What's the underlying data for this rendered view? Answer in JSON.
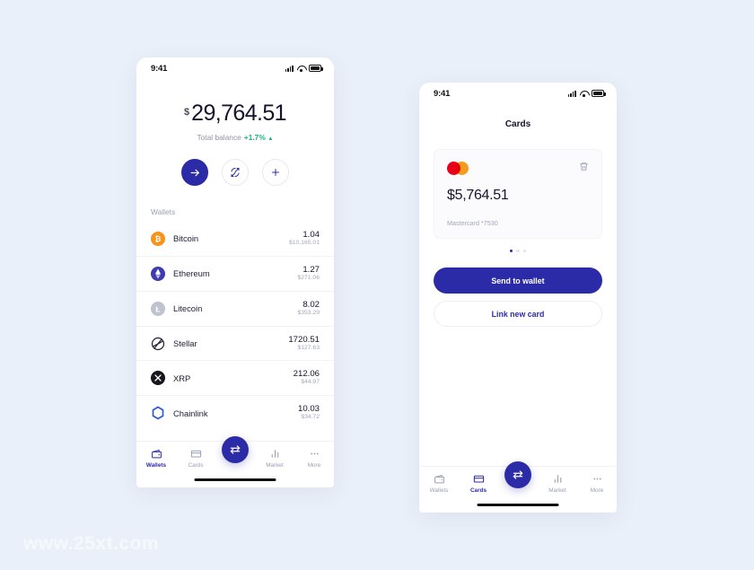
{
  "watermark": "www.25xt.com",
  "colors": {
    "background": "#eaf0f9",
    "primary": "#2b2ba8",
    "positive": "#22b07d",
    "muted": "#9aa0b4",
    "bitcoin": "#f7931a",
    "ethereum": "#3c3cad",
    "litecoin": "#bfc3d0",
    "stellar": "#202030",
    "xrp": "#16161c",
    "chainlink": "#2a5ada",
    "mastercard_red": "#eb001b",
    "mastercard_orange": "#f79e1b"
  },
  "wallets_screen": {
    "status_bar": {
      "time": "9:41",
      "signal_icon": "signal-bars-icon",
      "wifi_icon": "wifi-icon",
      "battery_icon": "battery-icon"
    },
    "balance": {
      "currency_symbol": "$",
      "amount": "29,764.51",
      "label": "Total balance",
      "change": "+1.7%",
      "change_caret": "▲"
    },
    "actions": [
      {
        "name": "send-button",
        "icon": "arrow-right-icon"
      },
      {
        "name": "exchange-button",
        "icon": "refresh-swap-icon"
      },
      {
        "name": "add-button",
        "icon": "plus-icon"
      }
    ],
    "section_title": "Wallets",
    "wallets": [
      {
        "icon": "bitcoin-icon",
        "name": "Bitcoin",
        "amount": "1.04",
        "fiat": "$10,165.01"
      },
      {
        "icon": "ethereum-icon",
        "name": "Ethereum",
        "amount": "1.27",
        "fiat": "$271.06"
      },
      {
        "icon": "litecoin-icon",
        "name": "Litecoin",
        "amount": "8.02",
        "fiat": "$353.29"
      },
      {
        "icon": "stellar-icon",
        "name": "Stellar",
        "amount": "1720.51",
        "fiat": "$127.63"
      },
      {
        "icon": "xrp-icon",
        "name": "XRP",
        "amount": "212.06",
        "fiat": "$44.97"
      },
      {
        "icon": "chainlink-icon",
        "name": "Chainlink",
        "amount": "10.03",
        "fiat": "$34.72"
      }
    ],
    "tabbar": {
      "active": "Wallets",
      "fab_icon": "swap-arrows-icon",
      "items": [
        {
          "label": "Wallets",
          "icon": "wallet-icon"
        },
        {
          "label": "Cards",
          "icon": "card-icon"
        },
        {
          "label": "Market",
          "icon": "bar-chart-icon"
        },
        {
          "label": "More",
          "icon": "ellipsis-icon"
        }
      ]
    }
  },
  "cards_screen": {
    "status_bar": {
      "time": "9:41",
      "signal_icon": "signal-bars-icon",
      "wifi_icon": "wifi-icon",
      "battery_icon": "battery-icon"
    },
    "title": "Cards",
    "card": {
      "brand_icon": "mastercard-icon",
      "delete_icon": "trash-icon",
      "amount": "$5,764.51",
      "meta": "Mastercard *7530"
    },
    "pagination": {
      "count": 3,
      "active_index": 0
    },
    "buttons": {
      "primary": "Send to wallet",
      "secondary": "Link new card"
    },
    "tabbar": {
      "active": "Cards",
      "fab_icon": "swap-arrows-icon",
      "items": [
        {
          "label": "Wallets",
          "icon": "wallet-icon"
        },
        {
          "label": "Cards",
          "icon": "card-icon"
        },
        {
          "label": "Market",
          "icon": "bar-chart-icon"
        },
        {
          "label": "More",
          "icon": "ellipsis-icon"
        }
      ]
    }
  }
}
